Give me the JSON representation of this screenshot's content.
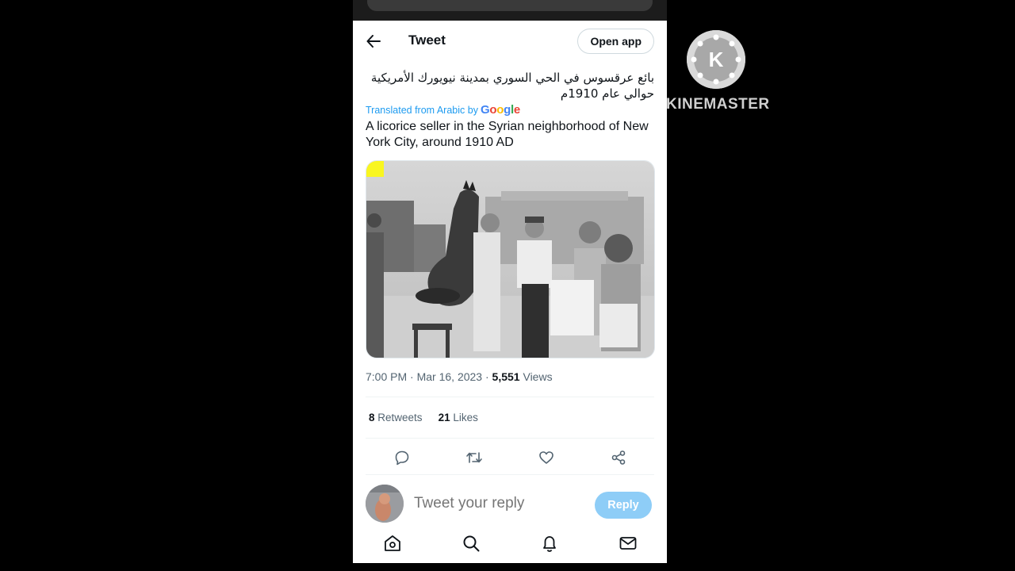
{
  "header": {
    "title": "Tweet",
    "open_app_label": "Open app"
  },
  "tweet": {
    "text_arabic": "بائع عرقسوس في الحي السوري بمدينة نيويورك الأمريكية حوالي عام 1910م",
    "translated_label": "Translated from Arabic by",
    "translated_provider": "Google",
    "text_english": "A licorice seller in the Syrian neighborhood of New York City, around 1910 AD",
    "time": "7:00 PM",
    "date": "Mar 16, 2023",
    "views_count": "5,551",
    "views_label": "Views",
    "retweets_count": "8",
    "retweets_label": "Retweets",
    "likes_count": "21",
    "likes_label": "Likes"
  },
  "reply": {
    "placeholder": "Tweet your reply",
    "button_label": "Reply"
  },
  "actions": [
    "reply-icon",
    "retweet-icon",
    "like-icon",
    "share-icon"
  ],
  "bottom_nav": [
    "home-icon",
    "search-icon",
    "notifications-icon",
    "messages-icon"
  ],
  "watermark": {
    "text": "KINEMASTER",
    "logo_letter": "K"
  },
  "colors": {
    "accent": "#1d9bf0",
    "reply_button": "#8ecdf7",
    "text_primary": "#0f1419",
    "text_secondary": "#536471"
  }
}
